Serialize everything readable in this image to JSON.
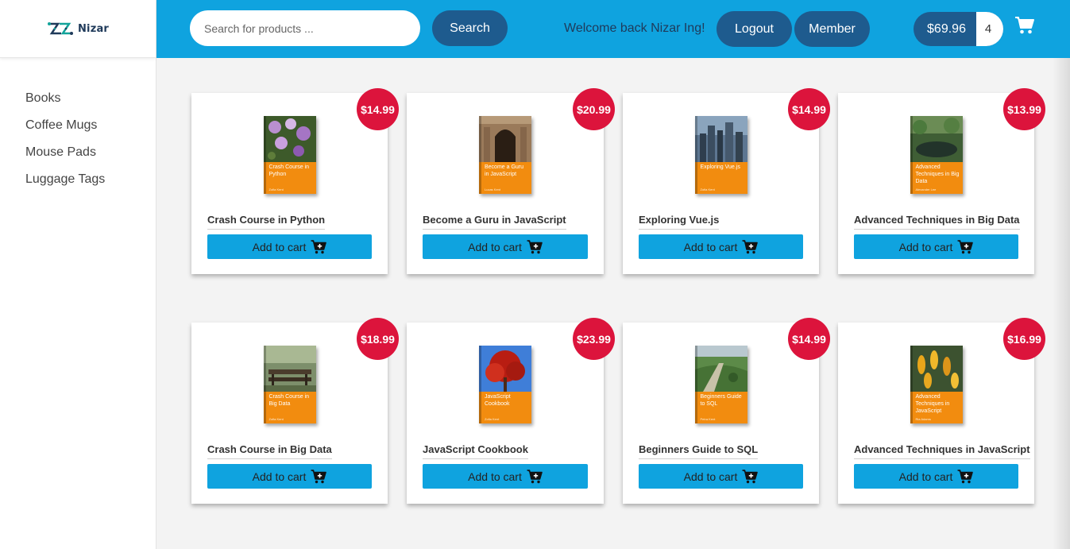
{
  "brand": {
    "name": "Nizar"
  },
  "sidebar": {
    "items": [
      {
        "label": "Books"
      },
      {
        "label": "Coffee Mugs"
      },
      {
        "label": "Mouse Pads"
      },
      {
        "label": "Luggage Tags"
      }
    ]
  },
  "header": {
    "search_placeholder": "Search for products ...",
    "search_value": "",
    "search_label": "Search",
    "welcome": "Welcome back Nizar Ing!",
    "logout_label": "Logout",
    "member_label": "Member",
    "cart_total": "$69.96",
    "cart_count": "4",
    "cart_icon": "shopping-cart-icon"
  },
  "colors": {
    "header_bg": "#0fa3df",
    "pill_bg": "#1e5b8e",
    "price_badge": "#dc143c",
    "book_cover": "#f28c0f"
  },
  "products": [
    {
      "name": "Crash Course in Python",
      "price": "$14.99",
      "button": "Add to cart",
      "cover_title": "Crash Course in Python",
      "cover_author": "Zofia Kent",
      "photo": "purple-orchids"
    },
    {
      "name": "Become a Guru in JavaScript",
      "price": "$20.99",
      "button": "Add to cart",
      "cover_title": "Become a Guru in JavaScript",
      "cover_author": "Lucas Kent",
      "photo": "stone-archway"
    },
    {
      "name": "Exploring Vue.js",
      "price": "$14.99",
      "button": "Add to cart",
      "cover_title": "Exploring Vue.js",
      "cover_author": "Zofia Kent",
      "photo": "city-skyline"
    },
    {
      "name": "Advanced Techniques in Big Data",
      "price": "$13.99",
      "button": "Add to cart",
      "cover_title": "Advanced Techniques in Big Data",
      "cover_author": "Alexander Lee",
      "photo": "pond-trees"
    },
    {
      "name": "Crash Course in Big Data",
      "price": "$18.99",
      "button": "Add to cart",
      "cover_title": "Crash Course in Big Data",
      "cover_author": "Zofia Kent",
      "photo": "forest-bench"
    },
    {
      "name": "JavaScript Cookbook",
      "price": "$23.99",
      "button": "Add to cart",
      "cover_title": "JavaScript Cookbook",
      "cover_author": "Zofia Kent",
      "photo": "red-maple-tree"
    },
    {
      "name": "Beginners Guide to SQL",
      "price": "$14.99",
      "button": "Add to cart",
      "cover_title": "Beginners Guide to SQL",
      "cover_author": "Petra Kent",
      "photo": "aerial-landscape"
    },
    {
      "name": "Advanced Techniques in JavaScript",
      "price": "$16.99",
      "button": "Add to cart",
      "cover_title": "Advanced Techniques in JavaScript",
      "cover_author": "Ria Adams",
      "photo": "yellow-flowers"
    }
  ]
}
